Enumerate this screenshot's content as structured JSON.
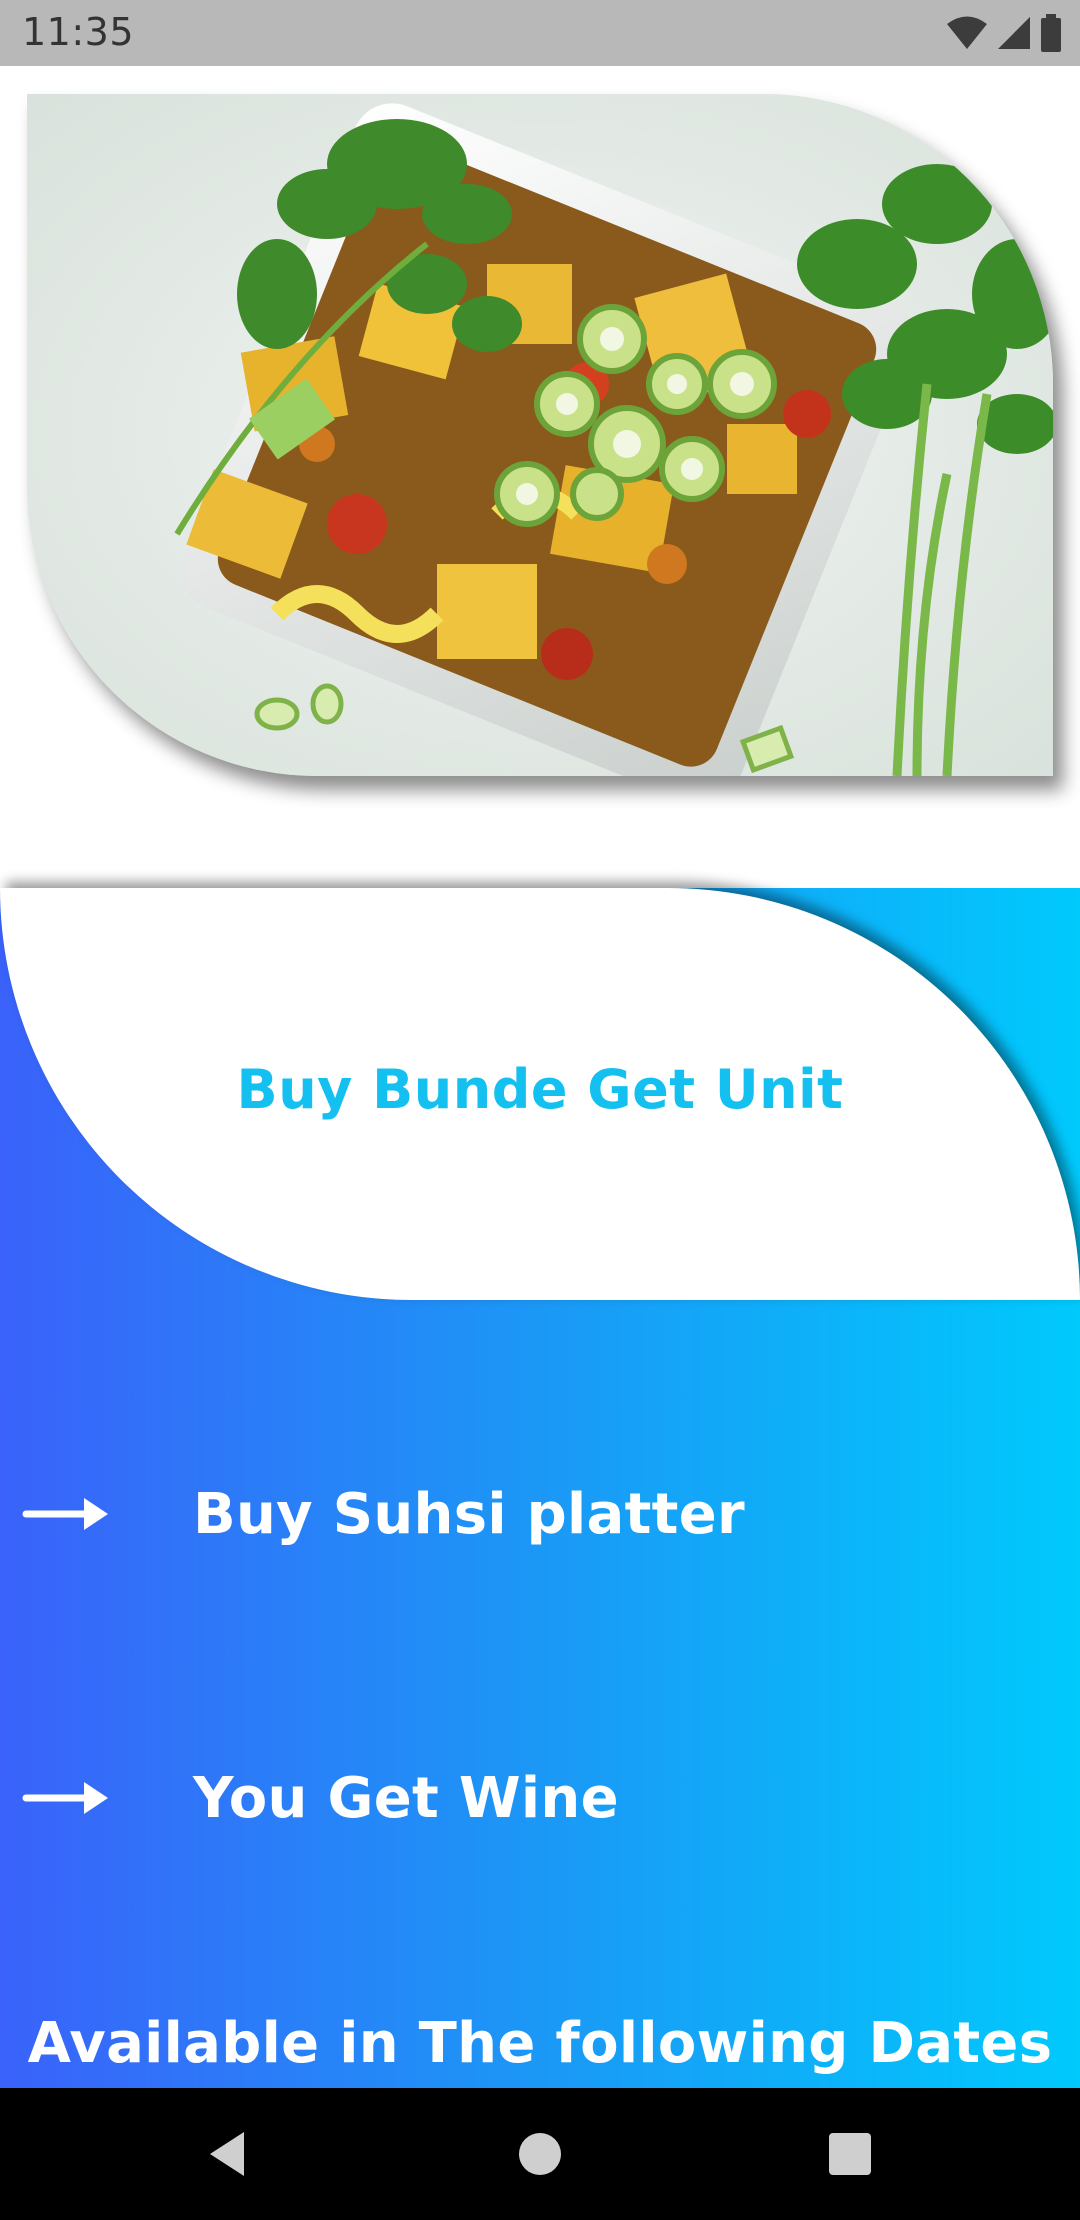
{
  "status_bar": {
    "time": "11:35",
    "icons": [
      "wifi-icon",
      "cellular-signal-icon",
      "battery-icon"
    ]
  },
  "hero_image": {
    "subject": "bowl of potato cauliflower curry with spring onions and cilantro"
  },
  "promo": {
    "title": "Buy Bunde Get Unit",
    "offers": [
      {
        "icon": "arrow-right-icon",
        "label": "Buy Suhsi platter"
      },
      {
        "icon": "arrow-right-icon",
        "label": "You Get Wine"
      }
    ],
    "dates_heading": "Available in The following Dates"
  },
  "colors": {
    "gradient_start": "#3a62fa",
    "gradient_end": "#00c9fc",
    "title_color": "#13c0f0"
  },
  "nav_bar": {
    "buttons": [
      "back-icon",
      "home-icon",
      "recents-icon"
    ]
  }
}
